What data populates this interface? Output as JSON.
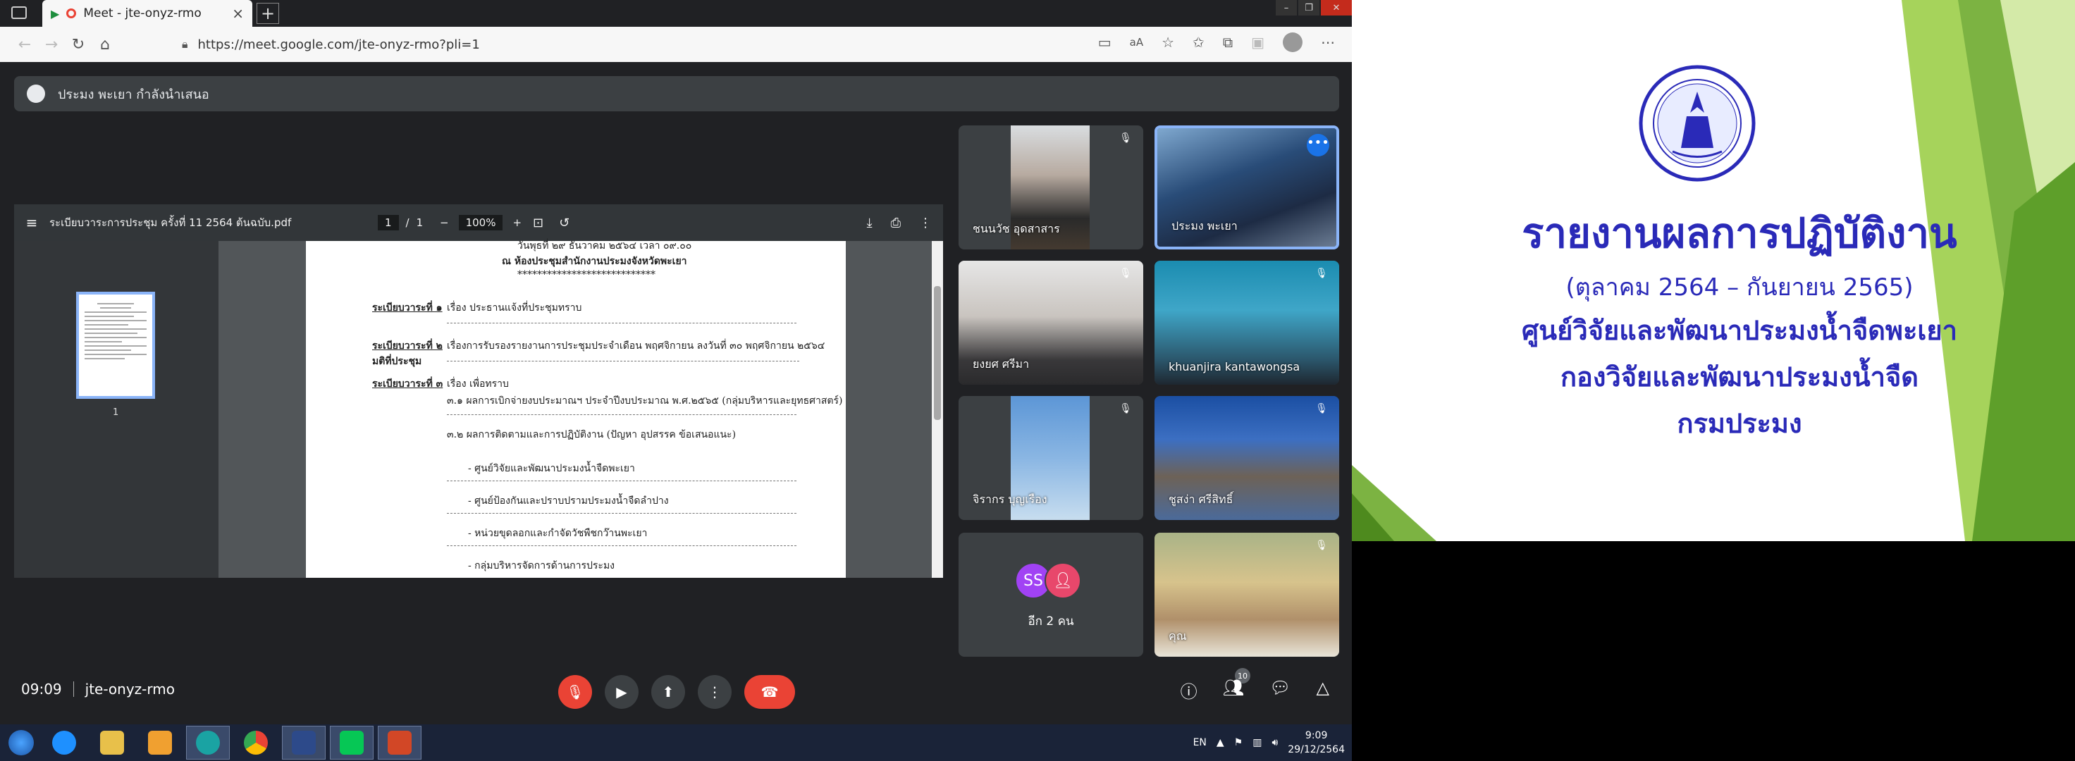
{
  "browser": {
    "tab_title": "Meet - jte-onyz-rmo",
    "new_tab": "+",
    "url": "https://meet.google.com/jte-onyz-rmo?pli=1"
  },
  "meet": {
    "presenter_banner": "ประมง พะเยา กำลังนำเสนอ",
    "time": "09:09",
    "meeting_code": "jte-onyz-rmo",
    "participant_count": "10",
    "pdf": {
      "filename": "ระเบียบวาระการประชุม ครั้งที่ 11 2564 ต้นฉบับ.pdf",
      "page_current": "1",
      "page_sep": "/",
      "page_total": "1",
      "zoom": "100%",
      "thumb_number": "1",
      "lines": [
        "วันพุธที่ ๒๙ ธันวาคม ๒๕๖๔ เวลา ๐๙.๐๐",
        "ณ  ห้องประชุมสำนักงานประมงจังหวัดพะเยา",
        "****************************",
        "ระเบียบวาระที่ ๑",
        "เรื่อง ประธานแจ้งที่ประชุมทราบ",
        "ระเบียบวาระที่ ๒",
        "เรื่องการรับรองรายงานการประชุมประจำเดือน พฤศจิกายน ลงวันที่ ๓๐ พฤศจิกายน ๒๕๖๔",
        "มติที่ประชุม",
        "ระเบียบวาระที่ ๓",
        "เรื่อง เพื่อทราบ",
        "๓.๑ ผลการเบิกจ่ายงบประมาณฯ ประจำปีงบประมาณ พ.ศ.๒๕๖๕ (กลุ่มบริหารและยุทธศาสตร์)",
        "๓.๒ ผลการติดตามและการปฏิบัติงาน (ปัญหา อุปสรรค ข้อเสนอแนะ)",
        "- ศูนย์วิจัยและพัฒนาประมงน้ำจืดพะเยา",
        "- ศูนย์ป้องกันและปราบปรามประมงน้ำจืดลำปาง",
        "- หน่วยขุดลอกและกำจัดวัชพืชกว๊านพะเยา",
        "- กลุ่มบริหารจัดการด้านการประมง"
      ]
    },
    "tiles": [
      {
        "name": "ชนนวัช อุดสาสาร"
      },
      {
        "name": "ประมง พะเยา"
      },
      {
        "name": "ยงยศ ศรีมา"
      },
      {
        "name": "khuanjira kantawongsa"
      },
      {
        "name": "จิรากร บุญเรือง"
      },
      {
        "name": "ชูสง่า ศรีสิทธิ์"
      },
      {
        "name": "อีก 2 คน",
        "initials": "SS"
      },
      {
        "name": "คุณ"
      }
    ]
  },
  "taskbar": {
    "lang": "EN",
    "time": "9:09",
    "date": "29/12/2564"
  },
  "slide": {
    "title": "รายงานผลการปฏิบัติงาน",
    "period": "(ตุลาคม 2564 – กันยายน 2565)",
    "org1": "ศูนย์วิจัยและพัฒนาประมงน้ำจืดพะเยา",
    "org2": "กองวิจัยและพัฒนาประมงน้ำจืด",
    "org3": "กรมประมง"
  },
  "colors": {
    "meet_bg": "#202124",
    "tile_bg": "#3c4043",
    "active_border": "#8ab4f8",
    "end_call": "#ea4335",
    "slide_text": "#2a2ab8",
    "slide_green": "#8dc63f"
  }
}
